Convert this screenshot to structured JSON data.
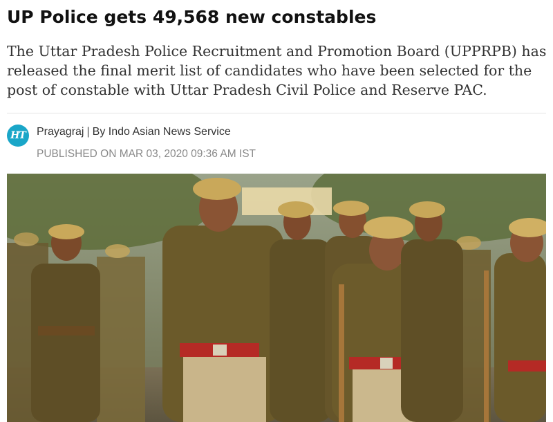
{
  "article": {
    "headline": "UP Police gets 49,568 new constables",
    "summary": "The Uttar Pradesh Police Recruitment and Promotion Board (UPPRPB) has released the final merit list of candidates who have been selected for the post of constable with Uttar Pradesh Civil Police and Reserve PAC.",
    "byline": {
      "logo_text": "HT",
      "location": "Prayagraj",
      "separator": "|",
      "author": "By Indo Asian News Service"
    },
    "published": "PUBLISHED ON MAR 03, 2020 09:36 AM IST"
  },
  "colors": {
    "logo_bg": "#1aa6c8",
    "uniform_khaki": "#6b5a2a",
    "belt_red": "#b52a25",
    "beret_khaki": "#c9a85a"
  }
}
